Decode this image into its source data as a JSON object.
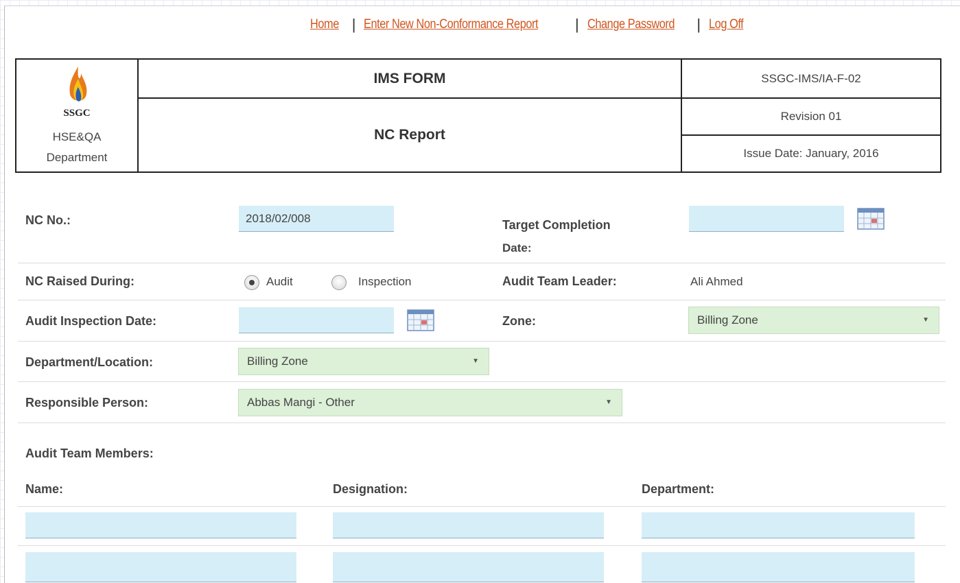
{
  "nav": {
    "links": [
      "Home",
      "Enter New Non-Conformance Report",
      "Change Password",
      "Log Off"
    ],
    "separator": "|"
  },
  "header": {
    "org": "SSGC",
    "dept_line1": "HSE&QA",
    "dept_line2": "Department",
    "form_title": "IMS FORM",
    "report_title": "NC Report",
    "doc_code": "SSGC-IMS/IA-F-02",
    "revision": "Revision 01",
    "issue_date": "Issue Date: January, 2016"
  },
  "form": {
    "nc_no_label": "NC No.:",
    "nc_no_value": "2018/02/008",
    "target_date_label_1": "Target Completion",
    "target_date_label_2": "Date:",
    "target_date_value": "",
    "raised_during_label": "NC Raised During:",
    "raised_options": [
      "Audit",
      "Inspection"
    ],
    "raised_selected": "Audit",
    "team_leader_label": "Audit Team Leader:",
    "team_leader_value": "Ali Ahmed",
    "inspection_date_label": "Audit Inspection Date:",
    "inspection_date_value": "",
    "zone_label": "Zone:",
    "zone_value": "Billing Zone",
    "dept_location_label": "Department/Location:",
    "dept_location_value": "Billing Zone",
    "responsible_label": "Responsible Person:",
    "responsible_value": "Abbas Mangi - Other",
    "team_members_label": "Audit Team Members:",
    "col_name": "Name:",
    "col_designation": "Designation:",
    "col_department": "Department:"
  },
  "icons": {
    "calendar": "calendar-icon",
    "flame": "flame-logo-icon",
    "caret": "▼"
  },
  "colors": {
    "link": "#d0561f",
    "input_bg": "#d6eef7",
    "select_bg": "#ddf0d8"
  }
}
